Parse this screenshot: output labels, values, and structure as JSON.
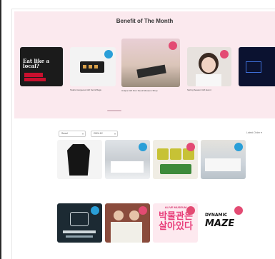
{
  "benefit": {
    "title": "Benefit of The Month",
    "cards": [
      {
        "badge": "",
        "caption": "",
        "sub": "",
        "art_text": "Eat like a local?"
      },
      {
        "badge": "",
        "caption": "Studio Gorgeous Gift Set & Bags",
        "sub": "",
        "art_text": ""
      },
      {
        "badge": "",
        "caption": "Unique Gift from Seoul Museum Shop",
        "sub": "",
        "art_text": ""
      },
      {
        "badge": "",
        "caption": "Spring Season Gift Event",
        "sub": "",
        "art_text": ""
      },
      {
        "badge": "",
        "caption": "",
        "sub": "",
        "art_text": ""
      }
    ]
  },
  "filters": {
    "filter1": "Seoul",
    "filter2": "2024.12",
    "sort": "Latest Order"
  },
  "products": [
    {
      "caption": "",
      "sub": "",
      "badge": ""
    },
    {
      "caption": "",
      "sub": "",
      "badge": ""
    },
    {
      "caption": "",
      "sub": "",
      "badge": ""
    },
    {
      "caption": "",
      "sub": "",
      "badge": ""
    },
    {
      "caption": "",
      "sub": "",
      "badge": ""
    },
    {
      "caption": "",
      "sub": "",
      "badge": ""
    },
    {
      "caption": "",
      "sub": "",
      "badge": "",
      "art_top": "ALIVE MUSEUM",
      "art_main": "박물관은 살아있다"
    },
    {
      "caption": "",
      "sub": "",
      "badge": "",
      "art_top": "DYNAMIC",
      "art_main": "MAZE"
    }
  ],
  "colors": {
    "band": "#fbe9ee",
    "badge_pink": "#e34b73",
    "badge_blue": "#2a9fd8"
  }
}
